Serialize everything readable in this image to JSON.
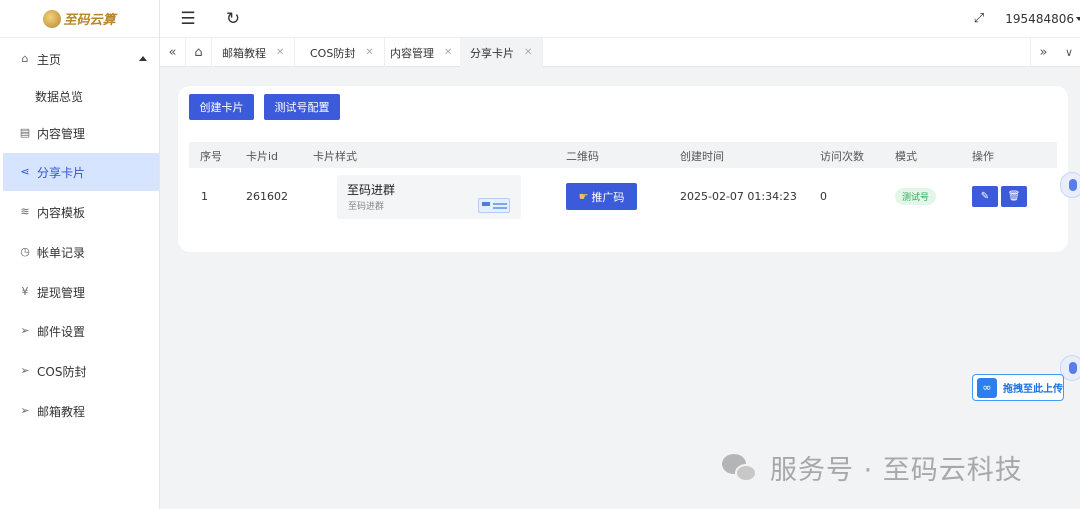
{
  "app": {
    "logo_text": "至码云算"
  },
  "sidebar": {
    "items": [
      {
        "label": "主页",
        "icon": "home-icon"
      },
      {
        "label": "数据总览"
      },
      {
        "label": "内容管理",
        "icon": "document-icon"
      },
      {
        "label": "分享卡片",
        "icon": "share-icon"
      },
      {
        "label": "内容模板",
        "icon": "layers-icon"
      },
      {
        "label": "帐单记录",
        "icon": "clock-icon"
      },
      {
        "label": "提现管理",
        "icon": "yen-icon"
      },
      {
        "label": "邮件设置",
        "icon": "send-icon"
      },
      {
        "label": "COS防封",
        "icon": "send-icon"
      },
      {
        "label": "邮箱教程",
        "icon": "send-icon"
      }
    ],
    "active_index": 3
  },
  "header": {
    "user_id": "195484806"
  },
  "tabs": [
    {
      "label": "邮箱教程"
    },
    {
      "label": "COS防封"
    },
    {
      "label": "内容管理"
    },
    {
      "label": "分享卡片",
      "active": true
    }
  ],
  "toolbar": {
    "create_label": "创建卡片",
    "test_config_label": "测试号配置"
  },
  "table": {
    "columns": [
      "序号",
      "卡片id",
      "卡片样式",
      "二维码",
      "创建时间",
      "访问次数",
      "模式",
      "操作"
    ],
    "rows": [
      {
        "index": "1",
        "card_id": "261602",
        "style_title": "至码进群",
        "style_subtitle": "至码进群",
        "qr_button": "推广码",
        "created_at": "2025-02-07 01:34:23",
        "visits": "0",
        "mode": "测试号"
      }
    ]
  },
  "upload_chip": {
    "label": "拖拽至此上传"
  },
  "watermark": {
    "text": "服务号 · 至码云科技"
  },
  "colors": {
    "primary": "#3b5bdb",
    "active_menu_bg": "#d6e4ff",
    "tag_green": "#2fa85a"
  }
}
